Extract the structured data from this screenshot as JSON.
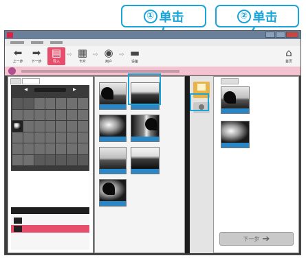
{
  "callouts": [
    {
      "num": "①",
      "label": "单击"
    },
    {
      "num": "②",
      "label": "单击"
    }
  ],
  "toolbar": {
    "items": [
      {
        "icon": "back-arrow-icon",
        "label": "上一步"
      },
      {
        "icon": "forward-arrow-icon",
        "label": "下一步"
      },
      {
        "icon": "import-icon",
        "label": "导入"
      },
      {
        "icon": "card-icon",
        "label": "卡片"
      },
      {
        "icon": "user-icon",
        "label": "用户"
      },
      {
        "icon": "device-icon",
        "label": "设备"
      },
      {
        "icon": "home-icon",
        "label": "首页"
      }
    ]
  },
  "right_panel": {
    "next_label": "下一步"
  },
  "colors": {
    "accent": "#1aa5d8",
    "selection": "#e64e6b",
    "caption": "#2b86c5"
  }
}
